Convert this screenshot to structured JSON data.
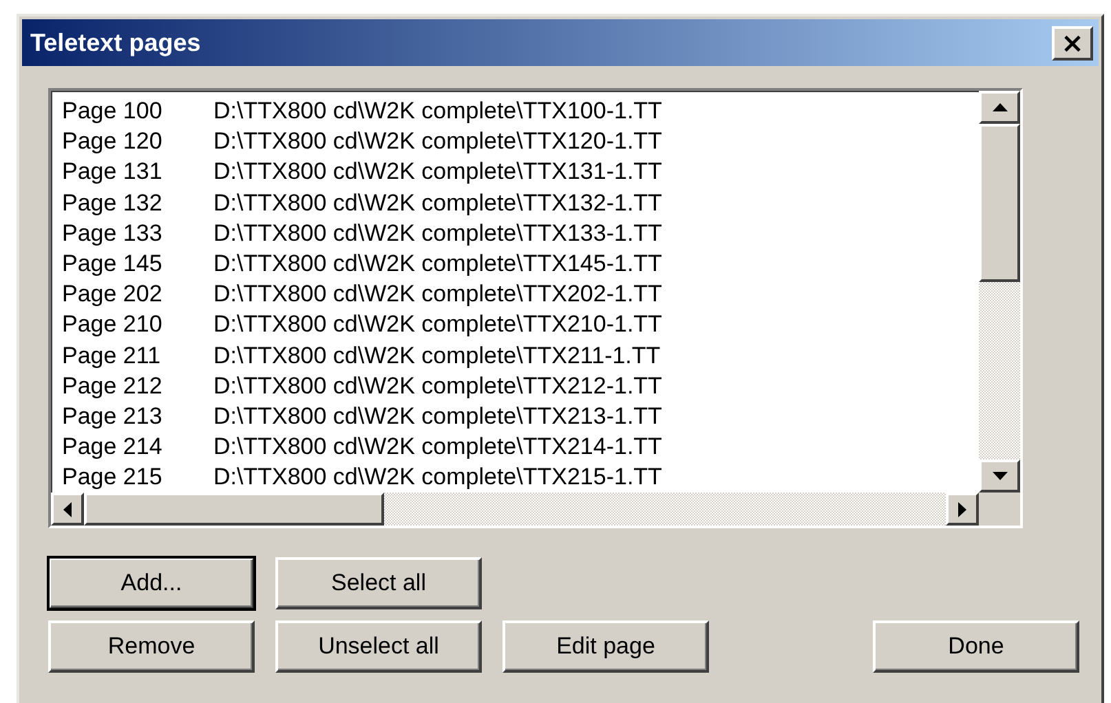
{
  "window": {
    "title": "Teletext pages",
    "close": "×"
  },
  "list": {
    "rows": [
      {
        "page": "Page 100",
        "path": "D:\\TTX800 cd\\W2K complete\\TTX100-1.TT"
      },
      {
        "page": "Page 120",
        "path": "D:\\TTX800 cd\\W2K complete\\TTX120-1.TT"
      },
      {
        "page": "Page 131",
        "path": "D:\\TTX800 cd\\W2K complete\\TTX131-1.TT"
      },
      {
        "page": "Page 132",
        "path": "D:\\TTX800 cd\\W2K complete\\TTX132-1.TT"
      },
      {
        "page": "Page 133",
        "path": "D:\\TTX800 cd\\W2K complete\\TTX133-1.TT"
      },
      {
        "page": "Page 145",
        "path": "D:\\TTX800 cd\\W2K complete\\TTX145-1.TT"
      },
      {
        "page": "Page 202",
        "path": "D:\\TTX800 cd\\W2K complete\\TTX202-1.TT"
      },
      {
        "page": "Page 210",
        "path": "D:\\TTX800 cd\\W2K complete\\TTX210-1.TT"
      },
      {
        "page": "Page 211",
        "path": "D:\\TTX800 cd\\W2K complete\\TTX211-1.TT"
      },
      {
        "page": "Page 212",
        "path": "D:\\TTX800 cd\\W2K complete\\TTX212-1.TT"
      },
      {
        "page": "Page 213",
        "path": "D:\\TTX800 cd\\W2K complete\\TTX213-1.TT"
      },
      {
        "page": "Page 214",
        "path": "D:\\TTX800 cd\\W2K complete\\TTX214-1.TT"
      },
      {
        "page": "Page 215",
        "path": "D:\\TTX800 cd\\W2K complete\\TTX215-1.TT"
      }
    ]
  },
  "buttons": [
    {
      "label": "Add...",
      "default": true
    },
    {
      "label": "Select all",
      "default": false
    },
    {
      "label": "Remove",
      "default": false
    },
    {
      "label": "Unselect all",
      "default": false
    },
    {
      "label": "Edit page",
      "default": false
    },
    {
      "label": "Done",
      "default": false
    }
  ]
}
